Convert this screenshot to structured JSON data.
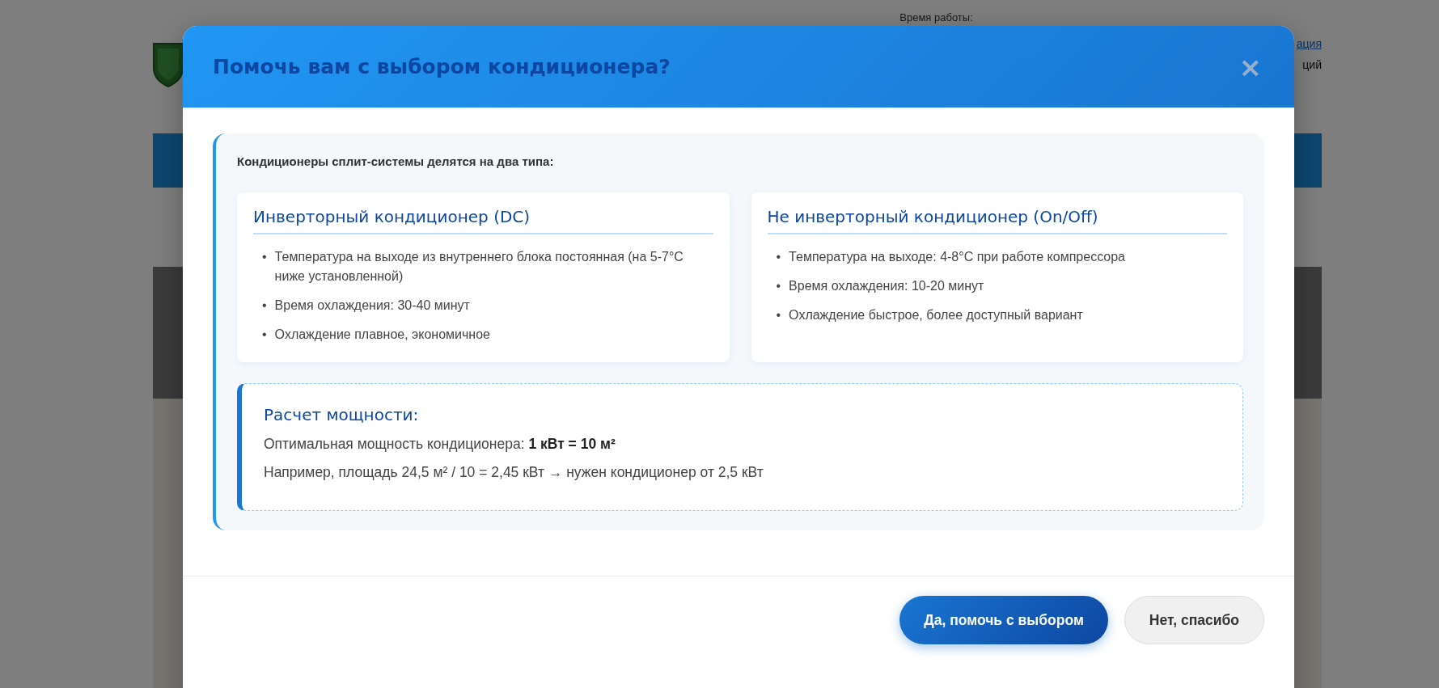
{
  "page": {
    "hours_label": "Время работы:",
    "link": "ация",
    "text": "ций"
  },
  "modal": {
    "title": "Помочь вам с выбором кондиционера?",
    "close": "×",
    "intro": "Кондиционеры сплит-системы делятся на два типа:",
    "cards": [
      {
        "title": "Инверторный кондиционер (DC)",
        "marker": "•",
        "items": [
          "Температура на выходе из внутреннего блока постоянная (на 5-7°C ниже установленной)",
          "Время охлаждения: 30-40 минут",
          "Охлаждение плавное, экономичное"
        ]
      },
      {
        "title": "Не инверторный кондиционер (On/Off)",
        "marker": "•",
        "items": [
          "Температура на выходе: 4-8°C при работе компрессора",
          "Время охлаждения: 10-20 минут",
          "Охлаждение быстрое, более доступный вариант"
        ]
      }
    ],
    "power": {
      "title": "Расчет мощности:",
      "lines": [
        "Оптимальная мощность кондиционера: **1 кВт = 10 м²**",
        "Например, площадь 24,5 м² / 10 = 2,45 кВт → нужен кондиционер от 2,5 кВт"
      ]
    },
    "buttons": [
      {
        "label": "Да, помочь с выбором",
        "kind": "primary"
      },
      {
        "label": "Нет, спасибо",
        "kind": "secondary"
      }
    ]
  }
}
